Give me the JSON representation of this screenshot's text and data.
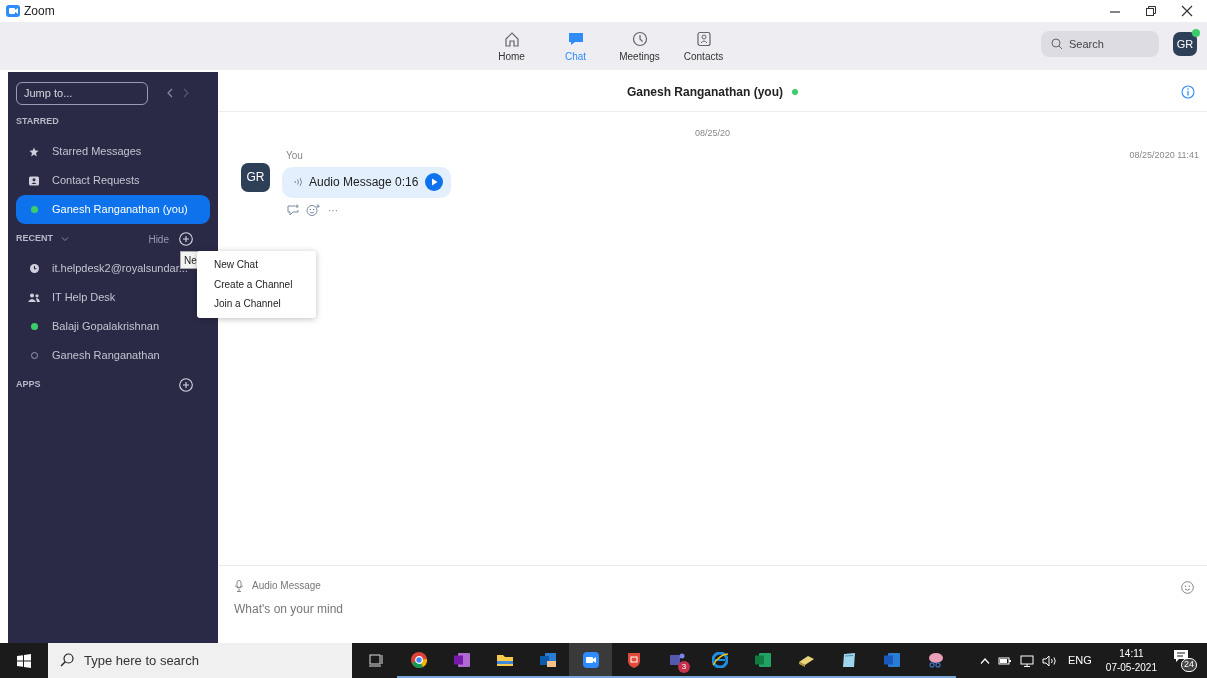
{
  "window": {
    "title": "Zoom"
  },
  "nav": {
    "tabs": [
      {
        "label": "Home",
        "kind": "home",
        "selected": false
      },
      {
        "label": "Chat",
        "kind": "chat",
        "selected": true
      },
      {
        "label": "Meetings",
        "kind": "clock",
        "selected": false
      },
      {
        "label": "Contacts",
        "kind": "contact",
        "selected": false
      }
    ],
    "search": {
      "placeholder": "Search"
    },
    "avatar": {
      "initials": "GR",
      "online": true
    }
  },
  "sidebar": {
    "jump": {
      "placeholder": "Jump to..."
    },
    "starred": {
      "heading": "STARRED",
      "items": [
        {
          "kind": "star",
          "label": "Starred Messages",
          "selected": false
        },
        {
          "kind": "card",
          "label": "Contact Requests",
          "selected": false
        },
        {
          "kind": "presence",
          "online": true,
          "label": "Ganesh Ranganathan (you)",
          "selected": true
        }
      ]
    },
    "recent": {
      "heading": "RECENT",
      "hide": "Hide",
      "items": [
        {
          "kind": "clock",
          "label": "it.helpdesk2@royalsundar...",
          "selected": false
        },
        {
          "kind": "group",
          "label": "IT Help Desk",
          "selected": false
        },
        {
          "kind": "presence",
          "online": true,
          "label": "Balaji Gopalakrishnan",
          "selected": false
        },
        {
          "kind": "presence",
          "online": false,
          "label": "Ganesh Ranganathan",
          "selected": false
        }
      ]
    },
    "apps": {
      "heading": "APPS"
    }
  },
  "tooltip": "Ne",
  "menu": [
    "New Chat",
    "Create a Channel",
    "Join a Channel"
  ],
  "chat": {
    "title": "Ganesh Ranganathan (you)",
    "online": true,
    "date": "08/25/20",
    "message": {
      "sender": "You",
      "avatar": "GR",
      "text": "Audio Message 0:16",
      "time": "08/25/2020 11:41",
      "more": "···"
    },
    "composer": {
      "label": "Audio Message",
      "placeholder": "What's on your mind"
    }
  },
  "taskbar": {
    "search": {
      "placeholder": "Type here to search"
    },
    "apps": [
      {
        "kind": "taskview",
        "active": false
      },
      {
        "kind": "chrome",
        "active": true
      },
      {
        "kind": "onenote",
        "active": true
      },
      {
        "kind": "folder",
        "active": true
      },
      {
        "kind": "outlook",
        "active": true
      },
      {
        "kind": "zoom",
        "active": true
      },
      {
        "kind": "shield",
        "active": true
      },
      {
        "kind": "teams",
        "active": true,
        "badge": "3"
      },
      {
        "kind": "ie",
        "active": true
      },
      {
        "kind": "excel",
        "active": true
      },
      {
        "kind": "yellow",
        "active": true
      },
      {
        "kind": "notepad",
        "active": true
      },
      {
        "kind": "word",
        "active": true
      },
      {
        "kind": "snip",
        "active": true
      }
    ],
    "lang": "ENG",
    "time": "14:11",
    "date": "07-05-2021",
    "notifications": "24"
  }
}
